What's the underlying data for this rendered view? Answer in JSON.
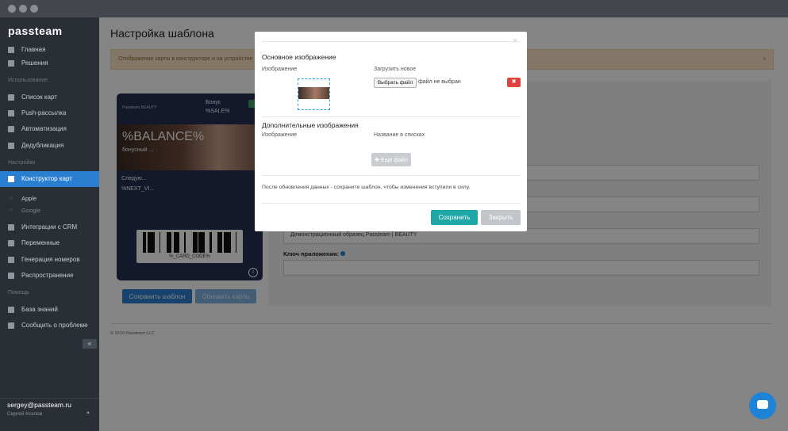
{
  "app": {
    "logo": "passteam"
  },
  "sidebar": {
    "items": [
      {
        "label": "Главная",
        "icon": "home-icon"
      },
      {
        "label": "Решения",
        "icon": "list-icon"
      },
      {
        "label": "Список карт",
        "icon": "list-icon"
      },
      {
        "label": "Push-рассылка",
        "icon": "megaphone-icon"
      },
      {
        "label": "Автоматизация",
        "icon": "gear-icon"
      },
      {
        "label": "Дедубликация",
        "icon": "copy-icon"
      },
      {
        "label": "Конструктор карт",
        "icon": "brush-icon",
        "active": true
      },
      {
        "label": "Интеграции с CRM",
        "icon": "plug-icon"
      },
      {
        "label": "Переменные",
        "icon": "list-icon"
      },
      {
        "label": "Генерация номеров",
        "icon": "grid-icon"
      },
      {
        "label": "Распространение",
        "icon": "bell-icon"
      },
      {
        "label": "База знаний",
        "icon": "lifebuoy-icon"
      },
      {
        "label": "Сообщить о проблеме",
        "icon": "gear-icon"
      }
    ],
    "sections": {
      "usage": "Использование",
      "settings": "Настройки",
      "help": "Помощь"
    },
    "subitems": {
      "apple": "Apple",
      "google": "Google"
    },
    "collapse_glyph": "«",
    "user": {
      "email": "sergey@passteam.ru",
      "name": "Сергей Козлов"
    }
  },
  "main": {
    "title": "Настройка шаблона",
    "alert_text": "Отображение карты в конструкторе и на устройстве",
    "alert_close": "×",
    "fields": {
      "org_name_value": "Демонстрационный образец Passteam | BEAUTY",
      "app_key_label": "Ключ приложения:"
    },
    "buttons": {
      "save_template": "Сохранить шаблон",
      "update_cards": "Обновить карты"
    },
    "copyright": "© 2019 Passteam LLC"
  },
  "card": {
    "logo": "Passteam BEAUTY",
    "bonus_label": "Бонус",
    "bonus_value": "%SALE%",
    "balance": "%BALANCE%",
    "balance_sub": "бонусный ...",
    "next_label": "Следую...",
    "next_value": "%NEXT_VI...",
    "barcode_text": "%_CARD_CODE%",
    "info_glyph": "i"
  },
  "modal": {
    "close_glyph": "×",
    "main_image_heading": "Основное изображение",
    "image_col": "Изображение",
    "upload_col": "Загрузить новое",
    "choose_file": "Выбрать файл",
    "no_file": "файл не выбран",
    "delete_glyph": "✖",
    "extra_heading": "Дополнительные изображения",
    "extra_image_col": "Изображение",
    "extra_name_col": "Название в списках",
    "more_file": "✚ Еще файл",
    "note": "После обновления данных - сохраните шаблон, чтобы изменения вступили в силу.",
    "save": "Сохранить",
    "cancel": "Закрыть"
  },
  "colors": {
    "accent": "#2b7fd1",
    "save": "#1fa7a7",
    "danger": "#e0423f",
    "sidebar": "#2a2f36"
  }
}
